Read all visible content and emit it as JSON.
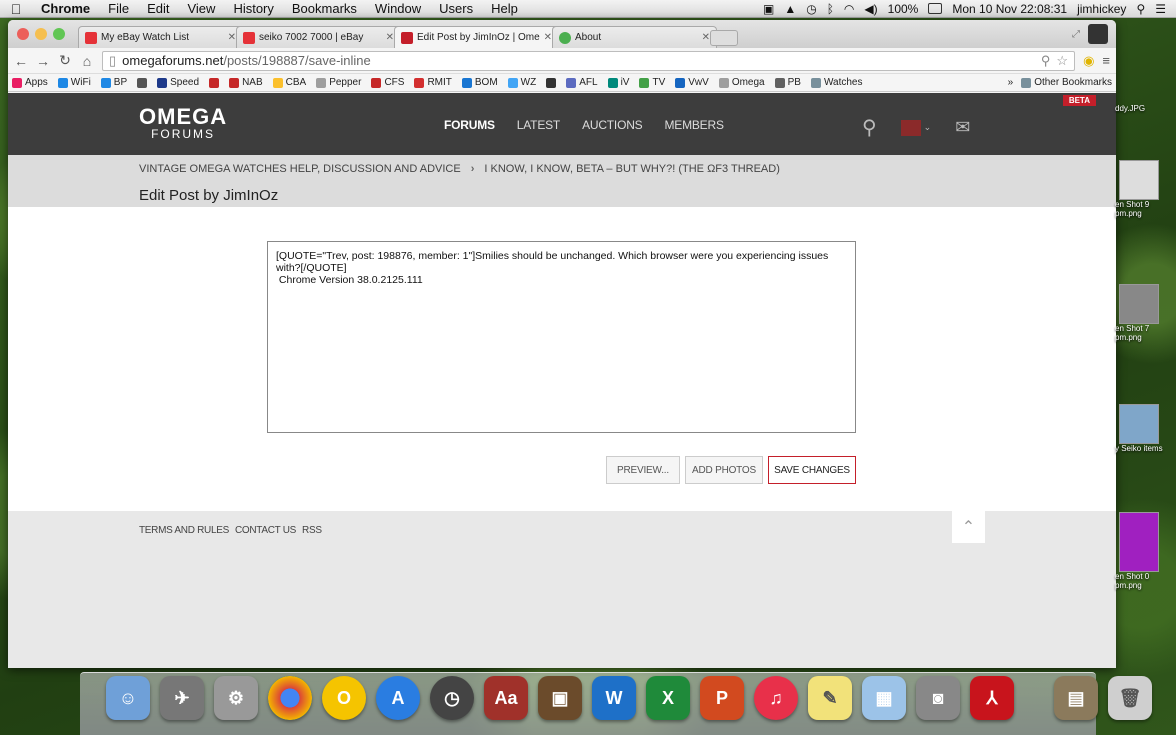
{
  "menubar": {
    "app": "Chrome",
    "items": [
      "File",
      "Edit",
      "View",
      "History",
      "Bookmarks",
      "Window",
      "Users",
      "Help"
    ],
    "battery": "100%",
    "clock": "Mon 10 Nov  22:08:31",
    "user": "jimhickey"
  },
  "tabs": [
    {
      "label": "My eBay Watch List",
      "fav": "#e53238"
    },
    {
      "label": "seiko 7002 7000 | eBay",
      "fav": "#e53238"
    },
    {
      "label": "Edit Post by JimInOz | Ome",
      "fav": "#c41f2a"
    },
    {
      "label": "About",
      "fav": "#4caf50"
    }
  ],
  "address": {
    "host": "omegaforums.net",
    "path": "/posts/198887/save-inline"
  },
  "bookmarks": [
    {
      "label": "Apps",
      "color": "#e91e63"
    },
    {
      "label": "WiFi",
      "color": "#1e88e5"
    },
    {
      "label": "BP",
      "color": "#1e88e5"
    },
    {
      "label": "",
      "color": "#555555"
    },
    {
      "label": "Speed",
      "color": "#1e3a8a"
    },
    {
      "label": "",
      "color": "#c62828"
    },
    {
      "label": "NAB",
      "color": "#c62828"
    },
    {
      "label": "CBA",
      "color": "#fbc02d"
    },
    {
      "label": "Pepper",
      "color": "#9e9e9e"
    },
    {
      "label": "CFS",
      "color": "#c62828"
    },
    {
      "label": "RMIT",
      "color": "#d32f2f"
    },
    {
      "label": "BOM",
      "color": "#1976d2"
    },
    {
      "label": "WZ",
      "color": "#42a5f5"
    },
    {
      "label": "",
      "color": "#333333"
    },
    {
      "label": "AFL",
      "color": "#5c6bc0"
    },
    {
      "label": "iV",
      "color": "#00897b"
    },
    {
      "label": "TV",
      "color": "#43a047"
    },
    {
      "label": "VwV",
      "color": "#1565c0"
    },
    {
      "label": "Omega",
      "color": "#9e9e9e"
    },
    {
      "label": "PB",
      "color": "#616161"
    },
    {
      "label": "Watches",
      "color": "#78909c"
    }
  ],
  "bookmarks_other": "Other Bookmarks",
  "site": {
    "logo_top": "OMEGA",
    "logo_bottom": "FORUMS",
    "beta": "BETA",
    "nav": [
      "FORUMS",
      "LATEST",
      "AUCTIONS",
      "MEMBERS"
    ],
    "breadcrumb": [
      "VINTAGE OMEGA WATCHES HELP, DISCUSSION AND ADVICE",
      "I KNOW, I KNOW, BETA – BUT WHY?! (THE ΩF3 THREAD)"
    ],
    "title": "Edit Post by JimInOz",
    "editor_text": "[QUOTE=\"Trev, post: 198876, member: 1\"]Smilies should be unchanged. Which browser were you experiencing issues with?[/QUOTE]\n Chrome Version 38.0.2125.111",
    "buttons": {
      "preview": "PREVIEW...",
      "photos": "ADD PHOTOS",
      "save": "SAVE CHANGES"
    },
    "footer": [
      "TERMS AND RULES",
      "CONTACT US",
      "RSS"
    ]
  },
  "desktop_icons": [
    {
      "label": "ddy.JPG"
    },
    {
      "label": "en Shot 9 pm.png"
    },
    {
      "label": "en Shot 7 pm.png"
    },
    {
      "label": "y Seiko items"
    },
    {
      "label": "en Shot 0 pm.png"
    }
  ]
}
